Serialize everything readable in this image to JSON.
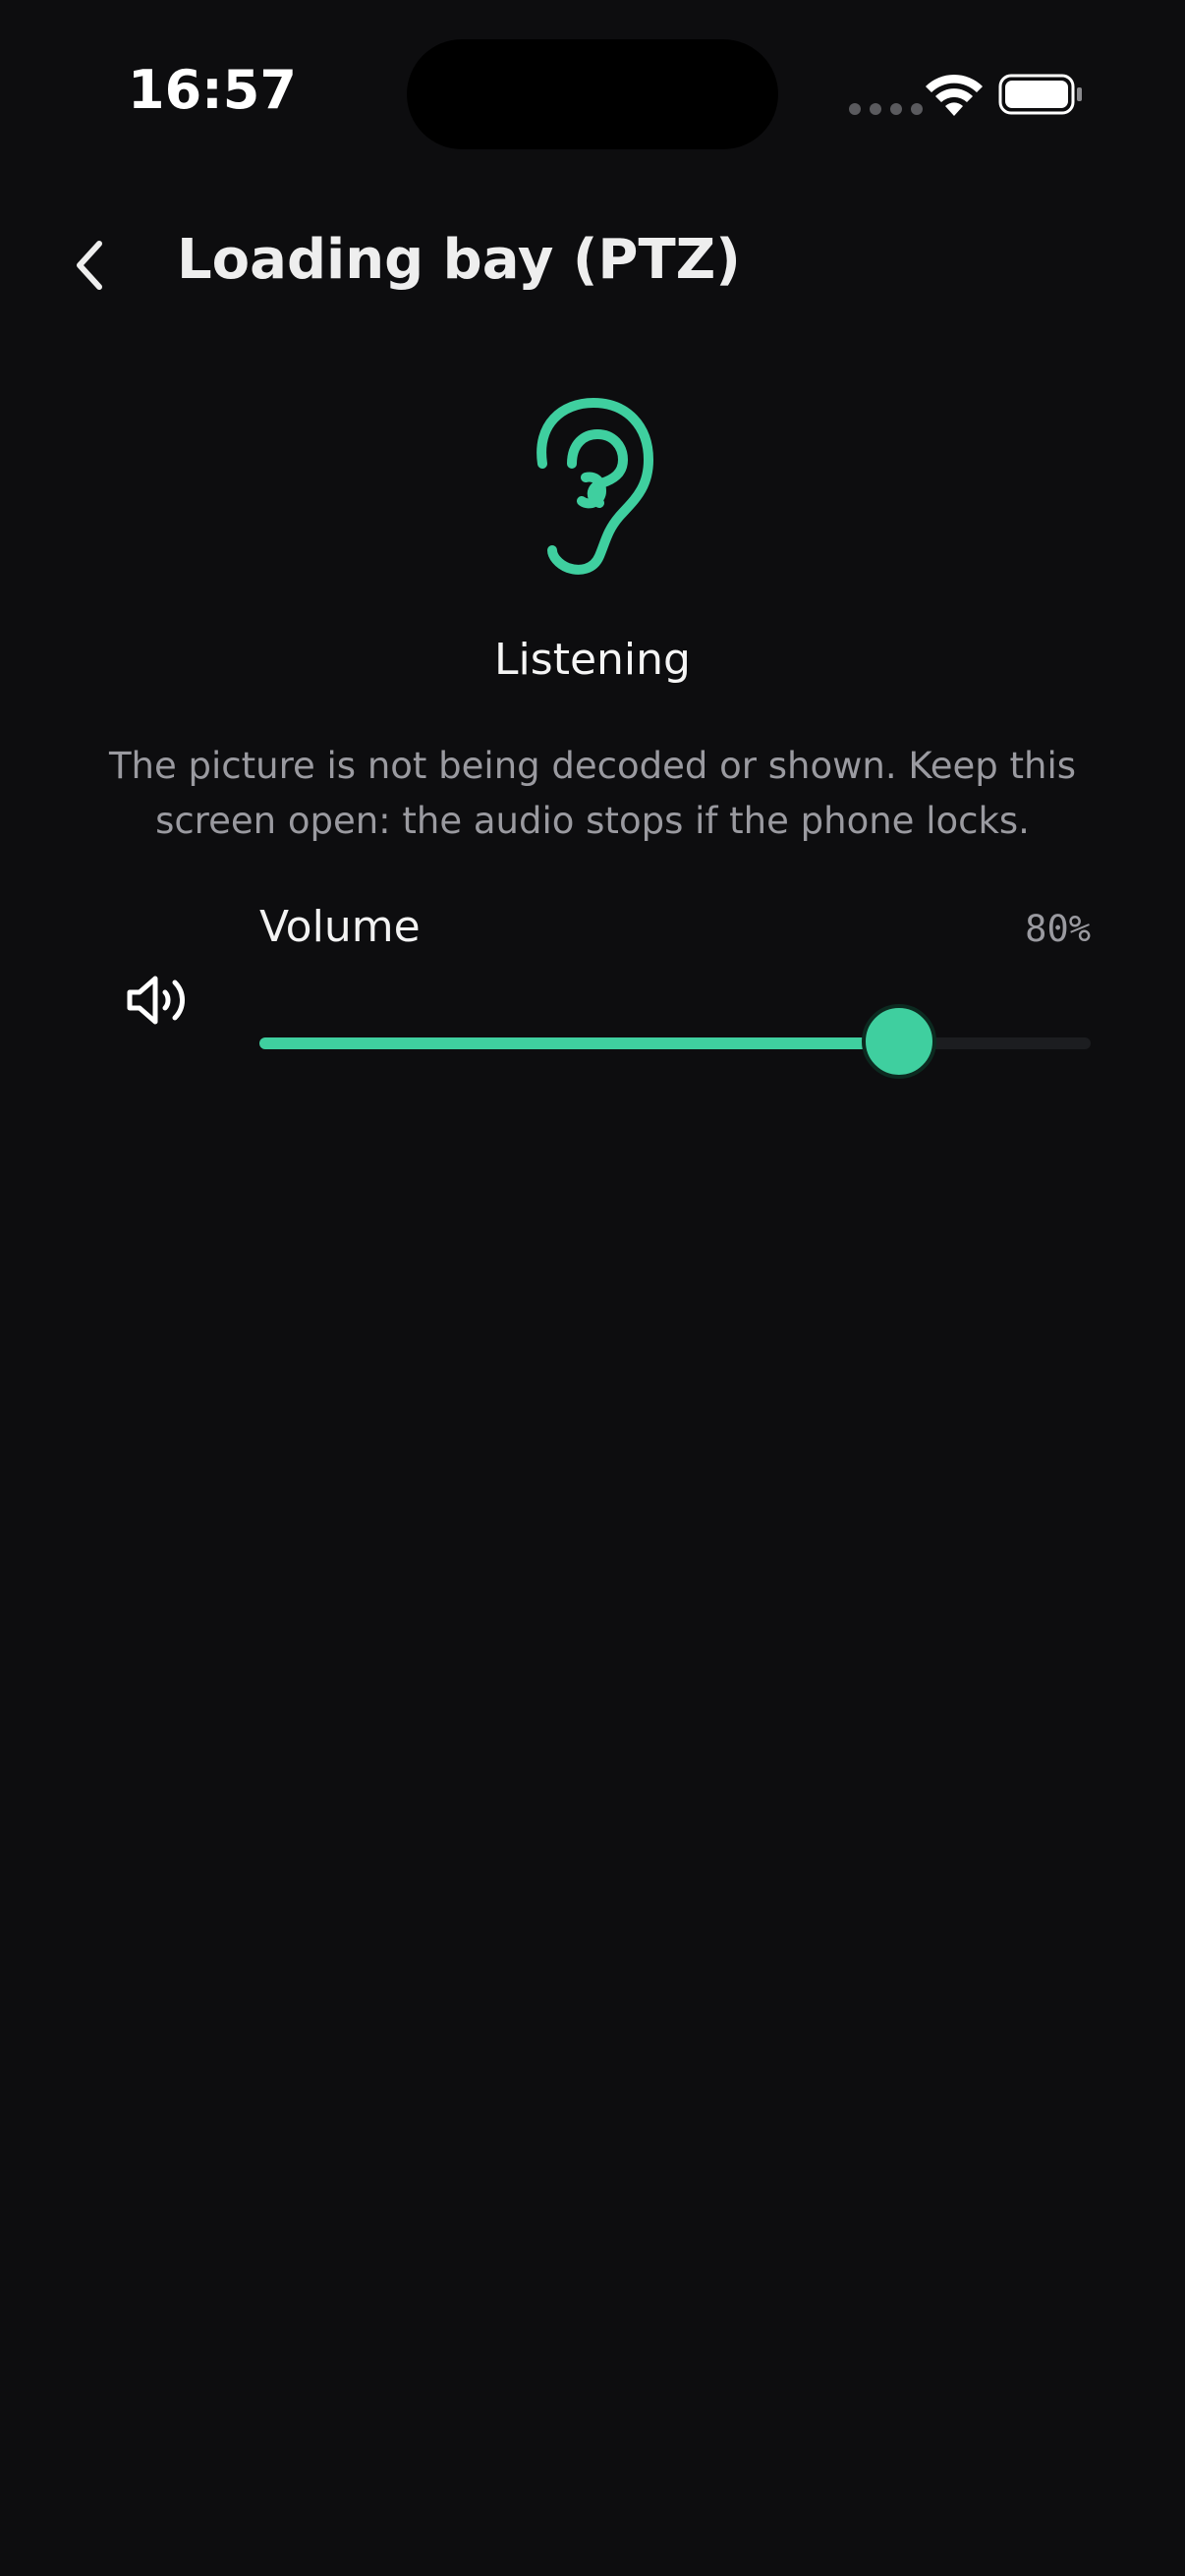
{
  "status_bar": {
    "time": "16:57"
  },
  "header": {
    "title": "Loading bay (PTZ)",
    "back_icon": "chevron-left-icon"
  },
  "listening": {
    "icon": "ear-icon",
    "label": "Listening",
    "description": "The picture is not being decoded or shown. Keep this screen open: the audio stops if the phone locks."
  },
  "volume": {
    "icon": "speaker-icon",
    "label": "Volume",
    "value_text": "80%",
    "level_percent": 77
  },
  "colors": {
    "accent": "#3fcf9f",
    "background": "#0d0d0f",
    "muted_text": "#9a9aa0"
  }
}
